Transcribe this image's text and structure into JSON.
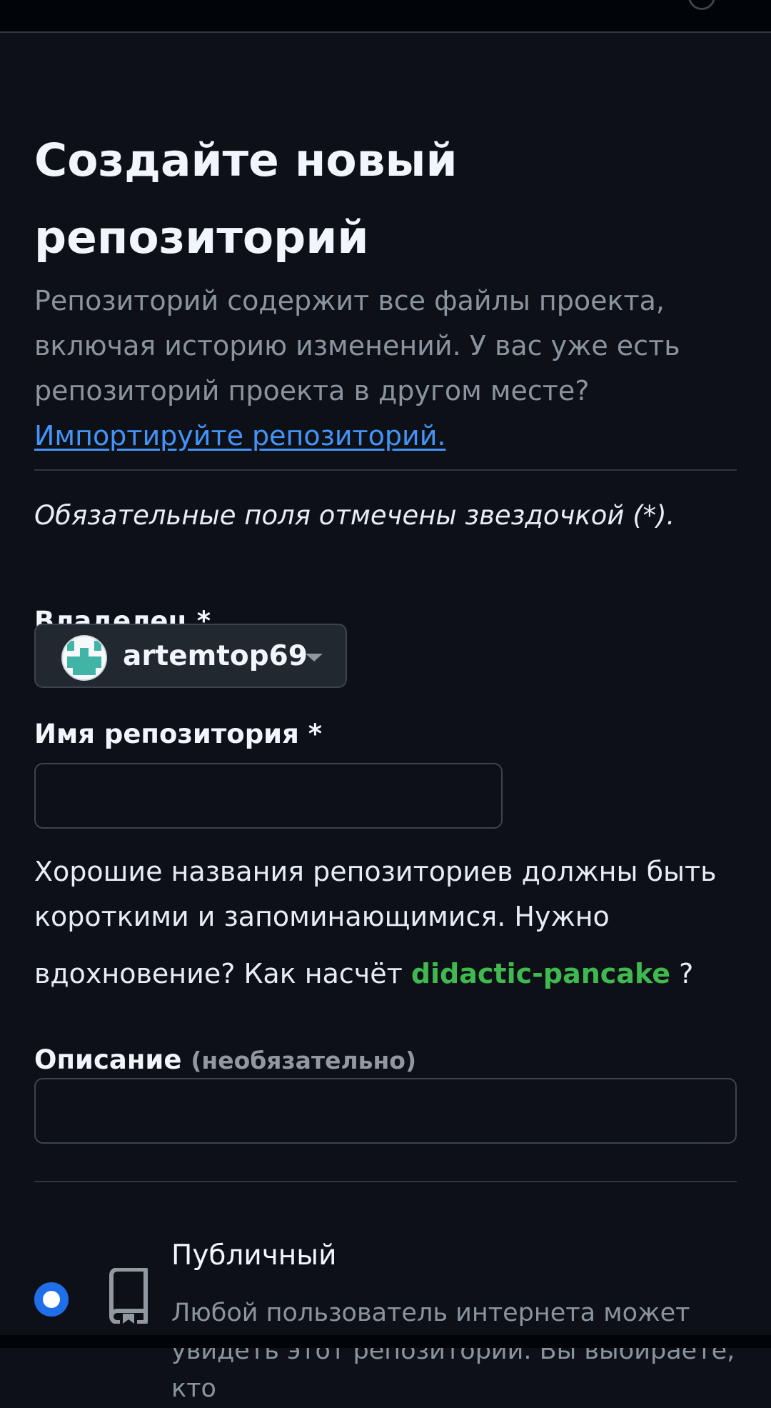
{
  "page": {
    "title": "Создайте новый репозиторий",
    "intro_text": "Репозиторий содержит все файлы проекта, включая историю изменений. У вас уже есть репозиторий проекта в другом месте? ",
    "import_link": "Импортируйте репозиторий.",
    "required_note": "Обязательные поля отмечены звездочкой (*)."
  },
  "owner": {
    "label": "Владелец *",
    "selected": "artemtop69",
    "avatar_color": "#40b4a6",
    "icon": "chevron-down-icon"
  },
  "repo_name": {
    "label": "Имя репозитория *",
    "value": "",
    "placeholder": "",
    "hint_text": "Хорошие названия репозиториев должны быть короткими и запоминающимися. Нужно ",
    "hint_line3": "вдохновение? Как насчёт ",
    "suggestion": "didactic-pancake",
    "hint_suffix": " ?"
  },
  "description": {
    "label": "Описание",
    "optional": "(необязательно)",
    "value": "",
    "placeholder": ""
  },
  "visibility": {
    "option_title": "Публичный",
    "option_desc": "Любой пользователь интернета может увидеть этот репозиторий. Вы выбираете, кто",
    "selected": true,
    "icon": "repo-book-icon",
    "accent_color": "#1f6feb"
  },
  "colors": {
    "background": "#0d1117",
    "link": "#4493f8",
    "suggestion": "#3fb950"
  }
}
